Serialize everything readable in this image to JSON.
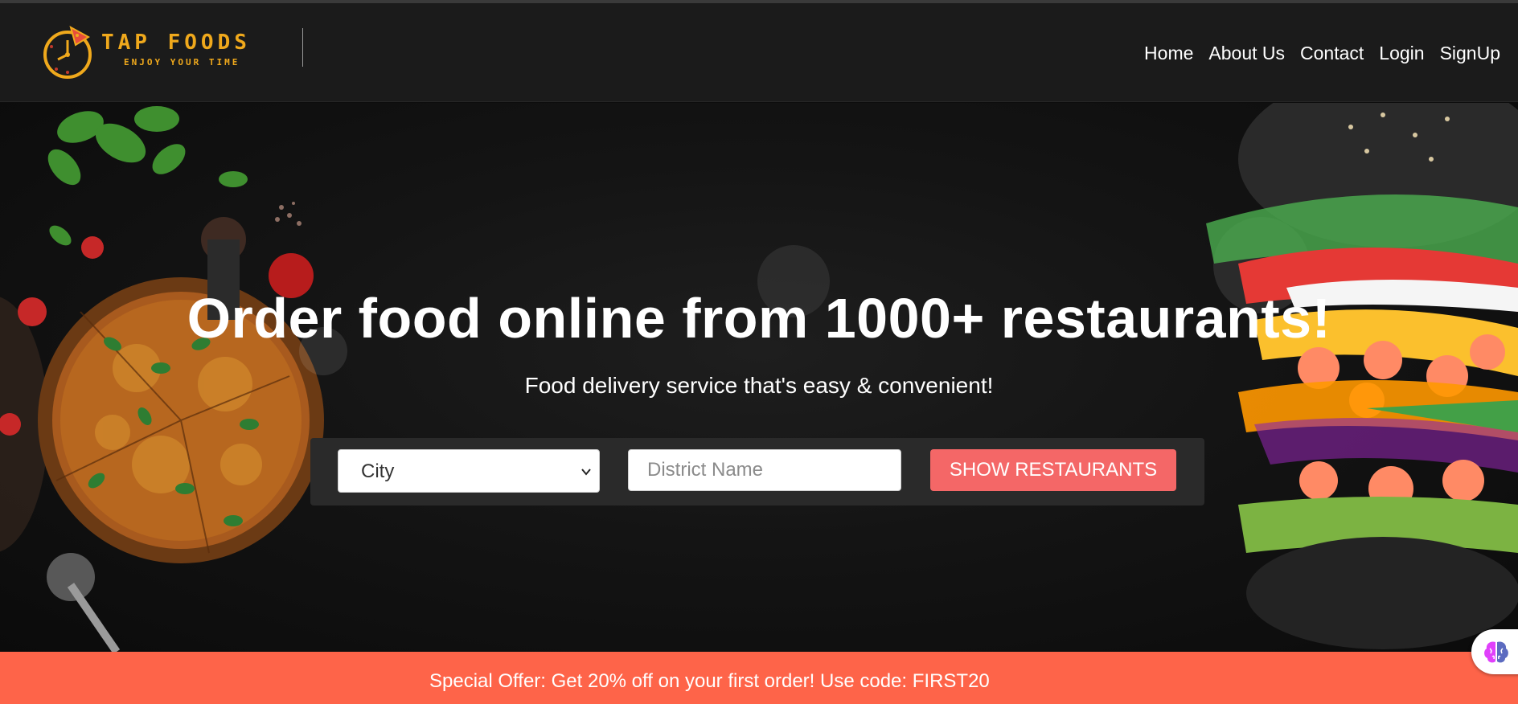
{
  "brand": {
    "name": "TAP FOODS",
    "tagline": "ENJOY YOUR TIME",
    "color": "#f0a91c"
  },
  "nav": {
    "links": [
      "Home",
      "About Us",
      "Contact",
      "Login",
      "SignUp"
    ]
  },
  "hero": {
    "title": "Order food online from 1000+ restaurants!",
    "subtitle": "Food delivery service that's easy & convenient!"
  },
  "search": {
    "city_selected": "City",
    "district_placeholder": "District Name",
    "button_label": "SHOW RESTAURANTS",
    "button_color": "#f46767"
  },
  "offer": {
    "text": "Special Offer: Get 20% off on your first order! Use code: FIRST20",
    "background": "#fe6449"
  },
  "icons": [
    "clock-logo-icon",
    "chevron-down-icon",
    "brain-assistant-icon"
  ]
}
